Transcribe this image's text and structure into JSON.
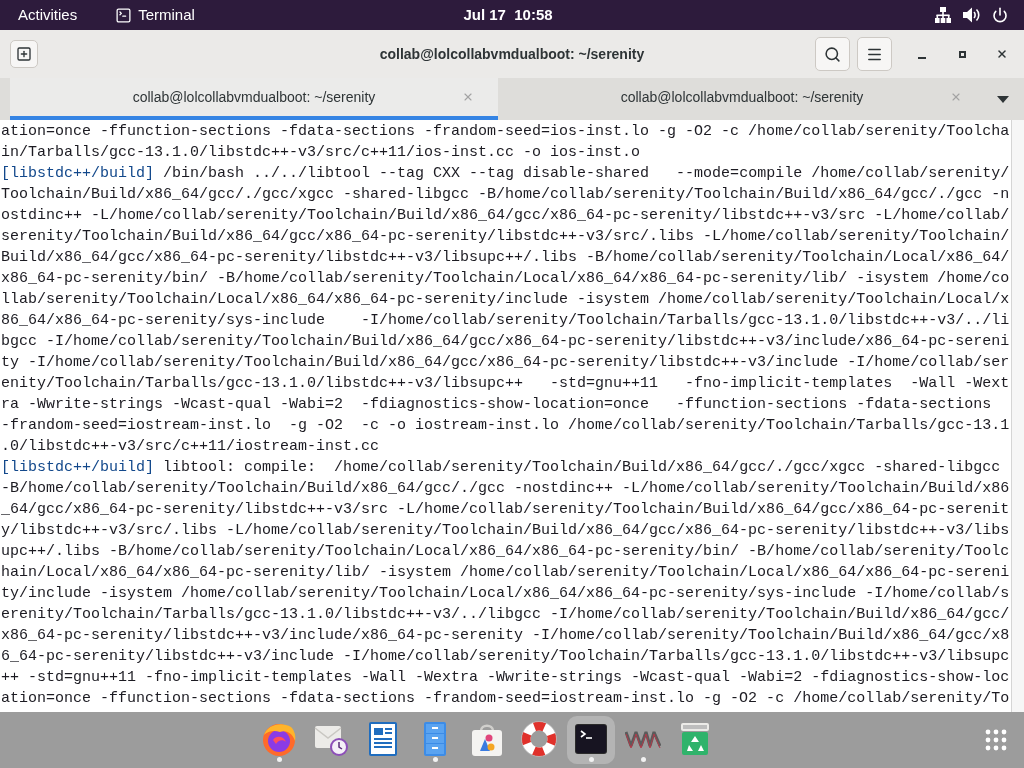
{
  "top_bar": {
    "activities": "Activities",
    "app_menu": "Terminal",
    "clock": "Jul 17  10:58"
  },
  "window": {
    "title": "collab@lolcollabvmdualboot: ~/serenity"
  },
  "tabs": [
    {
      "label": "collab@lolcollabvmdualboot: ~/serenity",
      "selected": true
    },
    {
      "label": "collab@lolcollabvmdualboot: ~/serenity",
      "selected": false
    }
  ],
  "terminal": {
    "lines": [
      {
        "text": "ation=once -ffunction-sections -fdata-sections -frandom-seed=ios-inst.lo -g -O2 -c /home/collab/serenity/Toolcha"
      },
      {
        "text": "in/Tarballs/gcc-13.1.0/libstdc++-v3/src/c++11/ios-inst.cc -o ios-inst.o"
      },
      {
        "tag": "[libstdc++/build]",
        "text": "/bin/bash ../../libtool --tag CXX --tag disable-shared   --mode=compile /home/collab/serenity/"
      },
      {
        "text": "Toolchain/Build/x86_64/gcc/./gcc/xgcc -shared-libgcc -B/home/collab/serenity/Toolchain/Build/x86_64/gcc/./gcc -n"
      },
      {
        "text": "ostdinc++ -L/home/collab/serenity/Toolchain/Build/x86_64/gcc/x86_64-pc-serenity/libstdc++-v3/src -L/home/collab/"
      },
      {
        "text": "serenity/Toolchain/Build/x86_64/gcc/x86_64-pc-serenity/libstdc++-v3/src/.libs -L/home/collab/serenity/Toolchain/"
      },
      {
        "text": "Build/x86_64/gcc/x86_64-pc-serenity/libstdc++-v3/libsupc++/.libs -B/home/collab/serenity/Toolchain/Local/x86_64/"
      },
      {
        "text": "x86_64-pc-serenity/bin/ -B/home/collab/serenity/Toolchain/Local/x86_64/x86_64-pc-serenity/lib/ -isystem /home/co"
      },
      {
        "text": "llab/serenity/Toolchain/Local/x86_64/x86_64-pc-serenity/include -isystem /home/collab/serenity/Toolchain/Local/x"
      },
      {
        "text": "86_64/x86_64-pc-serenity/sys-include    -I/home/collab/serenity/Toolchain/Tarballs/gcc-13.1.0/libstdc++-v3/../li"
      },
      {
        "text": "bgcc -I/home/collab/serenity/Toolchain/Build/x86_64/gcc/x86_64-pc-serenity/libstdc++-v3/include/x86_64-pc-sereni"
      },
      {
        "text": "ty -I/home/collab/serenity/Toolchain/Build/x86_64/gcc/x86_64-pc-serenity/libstdc++-v3/include -I/home/collab/ser"
      },
      {
        "text": "enity/Toolchain/Tarballs/gcc-13.1.0/libstdc++-v3/libsupc++   -std=gnu++11   -fno-implicit-templates  -Wall -Wext"
      },
      {
        "text": "ra -Wwrite-strings -Wcast-qual -Wabi=2  -fdiagnostics-show-location=once   -ffunction-sections -fdata-sections"
      },
      {
        "text": "-frandom-seed=iostream-inst.lo  -g -O2  -c -o iostream-inst.lo /home/collab/serenity/Toolchain/Tarballs/gcc-13.1"
      },
      {
        "text": ".0/libstdc++-v3/src/c++11/iostream-inst.cc"
      },
      {
        "tag": "[libstdc++/build]",
        "text": "libtool: compile:  /home/collab/serenity/Toolchain/Build/x86_64/gcc/./gcc/xgcc -shared-libgcc"
      },
      {
        "text": "-B/home/collab/serenity/Toolchain/Build/x86_64/gcc/./gcc -nostdinc++ -L/home/collab/serenity/Toolchain/Build/x86"
      },
      {
        "text": "_64/gcc/x86_64-pc-serenity/libstdc++-v3/src -L/home/collab/serenity/Toolchain/Build/x86_64/gcc/x86_64-pc-serenit"
      },
      {
        "text": "y/libstdc++-v3/src/.libs -L/home/collab/serenity/Toolchain/Build/x86_64/gcc/x86_64-pc-serenity/libstdc++-v3/libs"
      },
      {
        "text": "upc++/.libs -B/home/collab/serenity/Toolchain/Local/x86_64/x86_64-pc-serenity/bin/ -B/home/collab/serenity/Toolc"
      },
      {
        "text": "hain/Local/x86_64/x86_64-pc-serenity/lib/ -isystem /home/collab/serenity/Toolchain/Local/x86_64/x86_64-pc-sereni"
      },
      {
        "text": "ty/include -isystem /home/collab/serenity/Toolchain/Local/x86_64/x86_64-pc-serenity/sys-include -I/home/collab/s"
      },
      {
        "text": "erenity/Toolchain/Tarballs/gcc-13.1.0/libstdc++-v3/../libgcc -I/home/collab/serenity/Toolchain/Build/x86_64/gcc/"
      },
      {
        "text": "x86_64-pc-serenity/libstdc++-v3/include/x86_64-pc-serenity -I/home/collab/serenity/Toolchain/Build/x86_64/gcc/x8"
      },
      {
        "text": "6_64-pc-serenity/libstdc++-v3/include -I/home/collab/serenity/Toolchain/Tarballs/gcc-13.1.0/libstdc++-v3/libsupc"
      },
      {
        "text": "++ -std=gnu++11 -fno-implicit-templates -Wall -Wextra -Wwrite-strings -Wcast-qual -Wabi=2 -fdiagnostics-show-loc"
      },
      {
        "text": "ation=once -ffunction-sections -fdata-sections -frandom-seed=iostream-inst.lo -g -O2 -c /home/collab/serenity/To"
      }
    ]
  },
  "dock": {
    "items": [
      {
        "kind": "browser",
        "running": true,
        "selected": false
      },
      {
        "kind": "mail",
        "running": false,
        "selected": false
      },
      {
        "kind": "document",
        "running": false,
        "selected": false
      },
      {
        "kind": "files",
        "running": true,
        "selected": false
      },
      {
        "kind": "store",
        "running": false,
        "selected": false
      },
      {
        "kind": "help",
        "running": false,
        "selected": false
      },
      {
        "kind": "terminal",
        "running": true,
        "selected": true
      },
      {
        "kind": "vm",
        "running": true,
        "selected": false
      },
      {
        "kind": "trash",
        "running": false,
        "selected": false
      }
    ]
  }
}
